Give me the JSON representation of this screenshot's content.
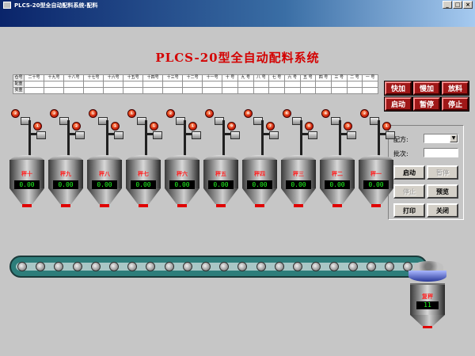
{
  "window": {
    "title": "PLCS-20型全自动配料系统-配料",
    "minimize": "_",
    "maximize": "□",
    "close": "×"
  },
  "main_title": "PLCS-20型全自动配料系统",
  "table": {
    "row_headers": [
      "仓号",
      "配重",
      "实重"
    ],
    "columns": [
      "二十号",
      "十九号",
      "十八号",
      "十七号",
      "十六号",
      "十五号",
      "十四号",
      "十三号",
      "十二号",
      "十一号",
      "十 号",
      "九 号",
      "八 号",
      "七 号",
      "六 号",
      "五 号",
      "四 号",
      "三 号",
      "二 号",
      "一 号"
    ]
  },
  "control_buttons": [
    "快加",
    "慢加",
    "放料",
    "启动",
    "暂停",
    "停止"
  ],
  "side_panel": {
    "recipe_label": "配方:",
    "recipe_value": "",
    "batch_label": "批次:",
    "batch_value": "",
    "start": "启动",
    "pause": "暂停",
    "stop": "停止",
    "preview": "预览",
    "print": "打印",
    "close": "关闭",
    "dropdown_arrow": "▼"
  },
  "hoppers": [
    {
      "name": "秤十",
      "value": "0.00",
      "top_ind": "②",
      "side_ind": "①"
    },
    {
      "name": "秤九",
      "value": "0.00",
      "top_ind": "②",
      "side_ind": "②"
    },
    {
      "name": "秤八",
      "value": "0.00",
      "top_ind": "①",
      "side_ind": "①"
    },
    {
      "name": "秤七",
      "value": "0.00",
      "top_ind": "①",
      "side_ind": "①"
    },
    {
      "name": "秤六",
      "value": "0.00",
      "top_ind": "②",
      "side_ind": "①"
    },
    {
      "name": "秤五",
      "value": "0.00",
      "top_ind": "①",
      "side_ind": "⑨"
    },
    {
      "name": "秤四",
      "value": "0.00",
      "top_ind": "⑧",
      "side_ind": "⑦"
    },
    {
      "name": "秤三",
      "value": "0.00",
      "top_ind": "⑥",
      "side_ind": "⑤"
    },
    {
      "name": "秤二",
      "value": "0.00",
      "top_ind": "④",
      "side_ind": "③"
    },
    {
      "name": "秤一",
      "value": "0.00",
      "top_ind": "②",
      "side_ind": "①"
    }
  ],
  "final_scale": {
    "name": "复秤",
    "value": "11"
  }
}
